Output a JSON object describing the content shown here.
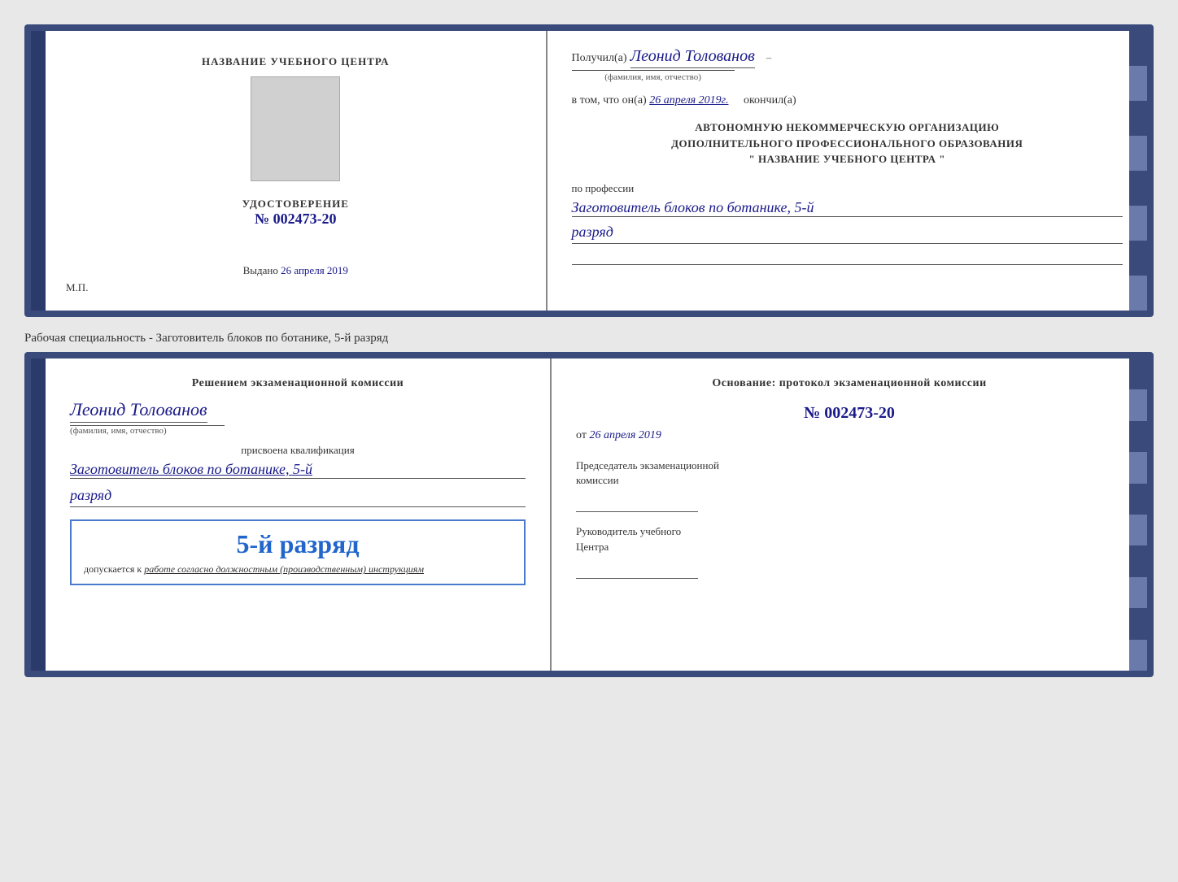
{
  "top_doc": {
    "left": {
      "center_label": "НАЗВАНИЕ УЧЕБНОГО ЦЕНТРА",
      "cert_title": "УДОСТОВЕРЕНИЕ",
      "cert_number_prefix": "№",
      "cert_number": "002473-20",
      "issued_prefix": "Выдано",
      "issued_date": "26 апреля 2019",
      "mp_label": "М.П."
    },
    "right": {
      "received_prefix": "Получил(а)",
      "recipient_name": "Леонид Толованов",
      "fio_label": "(фамилия, имя, отчество)",
      "in_that_prefix": "в том, что он(а)",
      "date_value": "26 апреля 2019г.",
      "finished_suffix": "окончил(а)",
      "org_line1": "АВТОНОМНУЮ НЕКОММЕРЧЕСКУЮ ОРГАНИЗАЦИЮ",
      "org_line2": "ДОПОЛНИТЕЛЬНОГО ПРОФЕССИОНАЛЬНОГО ОБРАЗОВАНИЯ",
      "org_line3": "\" НАЗВАНИЕ УЧЕБНОГО ЦЕНТРА \"",
      "profession_label": "по профессии",
      "profession_value": "Заготовитель блоков по ботанике, 5-й",
      "rank_value": "разряд"
    }
  },
  "between_label": "Рабочая специальность - Заготовитель блоков по ботанике, 5-й разряд",
  "bottom_doc": {
    "left": {
      "decision_line1": "Решением экзаменационной комиссии",
      "recipient_name": "Леонид Толованов",
      "fio_label": "(фамилия, имя, отчество)",
      "assigned_label": "присвоена квалификация",
      "qual_value": "Заготовитель блоков по ботанике, 5-й",
      "rank_value": "разряд",
      "stamp_rank": "5-й разряд",
      "stamp_allowed": "допускается к",
      "stamp_italic": "работе согласно должностным (производственным) инструкциям"
    },
    "right": {
      "basis_label": "Основание: протокол экзаменационной комиссии",
      "protocol_prefix": "№",
      "protocol_number": "002473-20",
      "from_prefix": "от",
      "from_date": "26 апреля 2019",
      "chairman_line1": "Председатель экзаменационной",
      "chairman_line2": "комиссии",
      "director_line1": "Руководитель учебного",
      "director_line2": "Центра"
    }
  }
}
